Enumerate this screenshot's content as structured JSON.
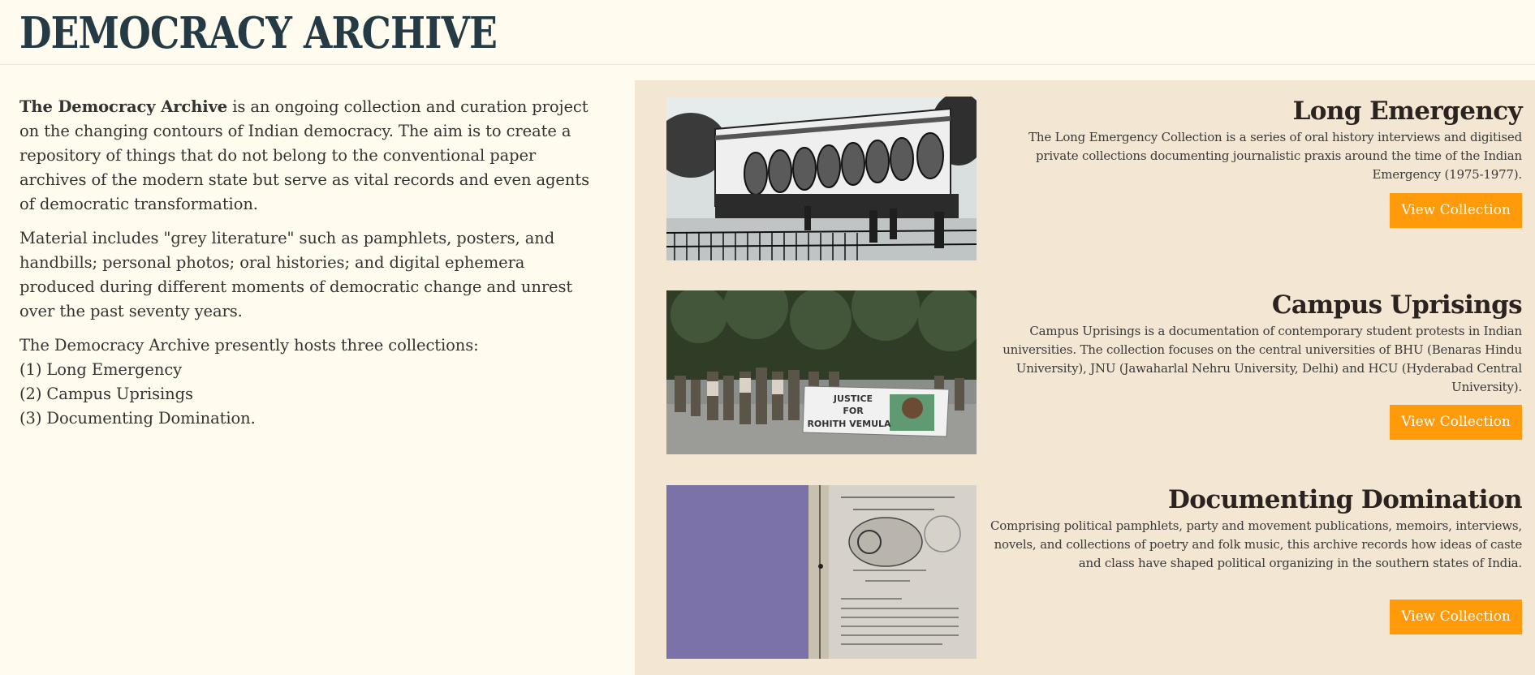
{
  "header": {
    "title": "DEMOCRACY ARCHIVE"
  },
  "intro": {
    "p1_strong": "The Democracy Archive",
    "p1_rest": " is an ongoing collection and curation project on the changing contours of Indian democracy. The aim is to create a repository of things that do not belong to the conventional paper archives of the modern state but serve as vital records and even agents of democratic transformation.",
    "p2": "Material includes \"grey literature\" such as pamphlets, posters, and handbills; personal photos; oral histories; and digital ephemera produced during different moments of democratic change and unrest over the past seventy years.",
    "p3_lead": "The Democracy Archive presently hosts three collections:",
    "list": [
      "(1) Long Emergency",
      "(2) Campus Uprisings",
      "(3) Documenting Domination."
    ]
  },
  "collections": [
    {
      "title": "Long Emergency",
      "description": "The Long Emergency Collection is a series of oral history interviews and digitised private collections documenting journalistic praxis around the time of the Indian Emergency (1975-1977).",
      "button": "View Collection"
    },
    {
      "title": "Campus Uprisings",
      "description": "Campus Uprisings is a documentation of contemporary student protests in Indian universities. The collection focuses on the central universities of BHU (Benaras Hindu University), JNU (Jawaharlal Nehru University, Delhi) and HCU (Hyderabad Central University).",
      "button": "View Collection",
      "banner_lines": [
        "JUSTICE",
        "FOR",
        "ROHITH VEMULA"
      ]
    },
    {
      "title": "Documenting Domination",
      "description": "Comprising political pamphlets, party and movement publications, memoirs, interviews, novels, and collections of poetry and folk music, this archive records how ideas of caste and class have shaped political organizing in the southern states of India.",
      "button": "View Collection"
    }
  ]
}
